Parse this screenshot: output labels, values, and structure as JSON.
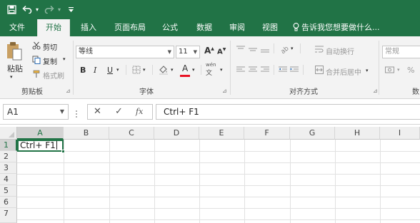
{
  "qat": {
    "save_icon": "save-icon",
    "undo_icon": "undo-icon",
    "redo_icon": "redo-icon",
    "customize_icon": "customize-qat-icon"
  },
  "tabs": [
    {
      "label": "文件",
      "active": false
    },
    {
      "label": "开始",
      "active": true
    },
    {
      "label": "插入",
      "active": false
    },
    {
      "label": "页面布局",
      "active": false
    },
    {
      "label": "公式",
      "active": false
    },
    {
      "label": "数据",
      "active": false
    },
    {
      "label": "审阅",
      "active": false
    },
    {
      "label": "视图",
      "active": false
    }
  ],
  "tell_me": "告诉我您想要做什么...",
  "clipboard": {
    "paste": "粘贴",
    "cut": "剪切",
    "copy": "复制",
    "format_painter": "格式刷",
    "group_label": "剪贴板"
  },
  "font": {
    "name": "等线",
    "size": "11",
    "grow": "A",
    "shrink": "A",
    "bold": "B",
    "italic": "I",
    "underline": "U",
    "font_color_glyph": "A",
    "phonetic": "wén",
    "group_label": "字体"
  },
  "alignment": {
    "wrap_text": "自动换行",
    "merge_center": "合并后居中",
    "group_label": "对齐方式"
  },
  "number": {
    "format": "常规",
    "percent": "%",
    "group_label": "数"
  },
  "formula_bar": {
    "name_box": "A1",
    "cancel": "✕",
    "enter": "✓",
    "fx": "fx",
    "content": "Ctrl+ F1"
  },
  "grid": {
    "columns": [
      "A",
      "B",
      "C",
      "D",
      "E",
      "F",
      "G",
      "H",
      "I"
    ],
    "rows": [
      "1",
      "2",
      "3",
      "4",
      "5",
      "6",
      "7"
    ],
    "active_cell_value": "Ctrl+ F1"
  },
  "colors": {
    "accent": "#217346",
    "ribbon_bg": "#f3f3f3",
    "font_color_bar": "#e81123"
  }
}
